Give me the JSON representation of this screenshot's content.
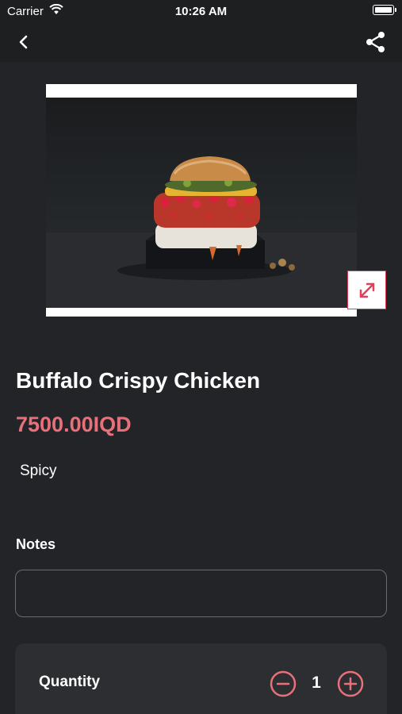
{
  "status_bar": {
    "carrier": "Carrier",
    "time": "10:26 AM"
  },
  "nav": {
    "back_icon": "chevron-left-icon",
    "share_icon": "share-icon"
  },
  "product": {
    "image_subject": "burger-photo",
    "name": "Buffalo Crispy Chicken",
    "price": "7500.00IQD",
    "tag": "Spicy"
  },
  "notes": {
    "label": "Notes",
    "value": "",
    "placeholder": ""
  },
  "quantity": {
    "label": "Quantity",
    "value": "1"
  },
  "colors": {
    "background": "#232427",
    "bar_background": "#1e1f21",
    "accent": "#e8707a",
    "expand_border": "#e0405a",
    "card_background": "#2d2e31"
  }
}
